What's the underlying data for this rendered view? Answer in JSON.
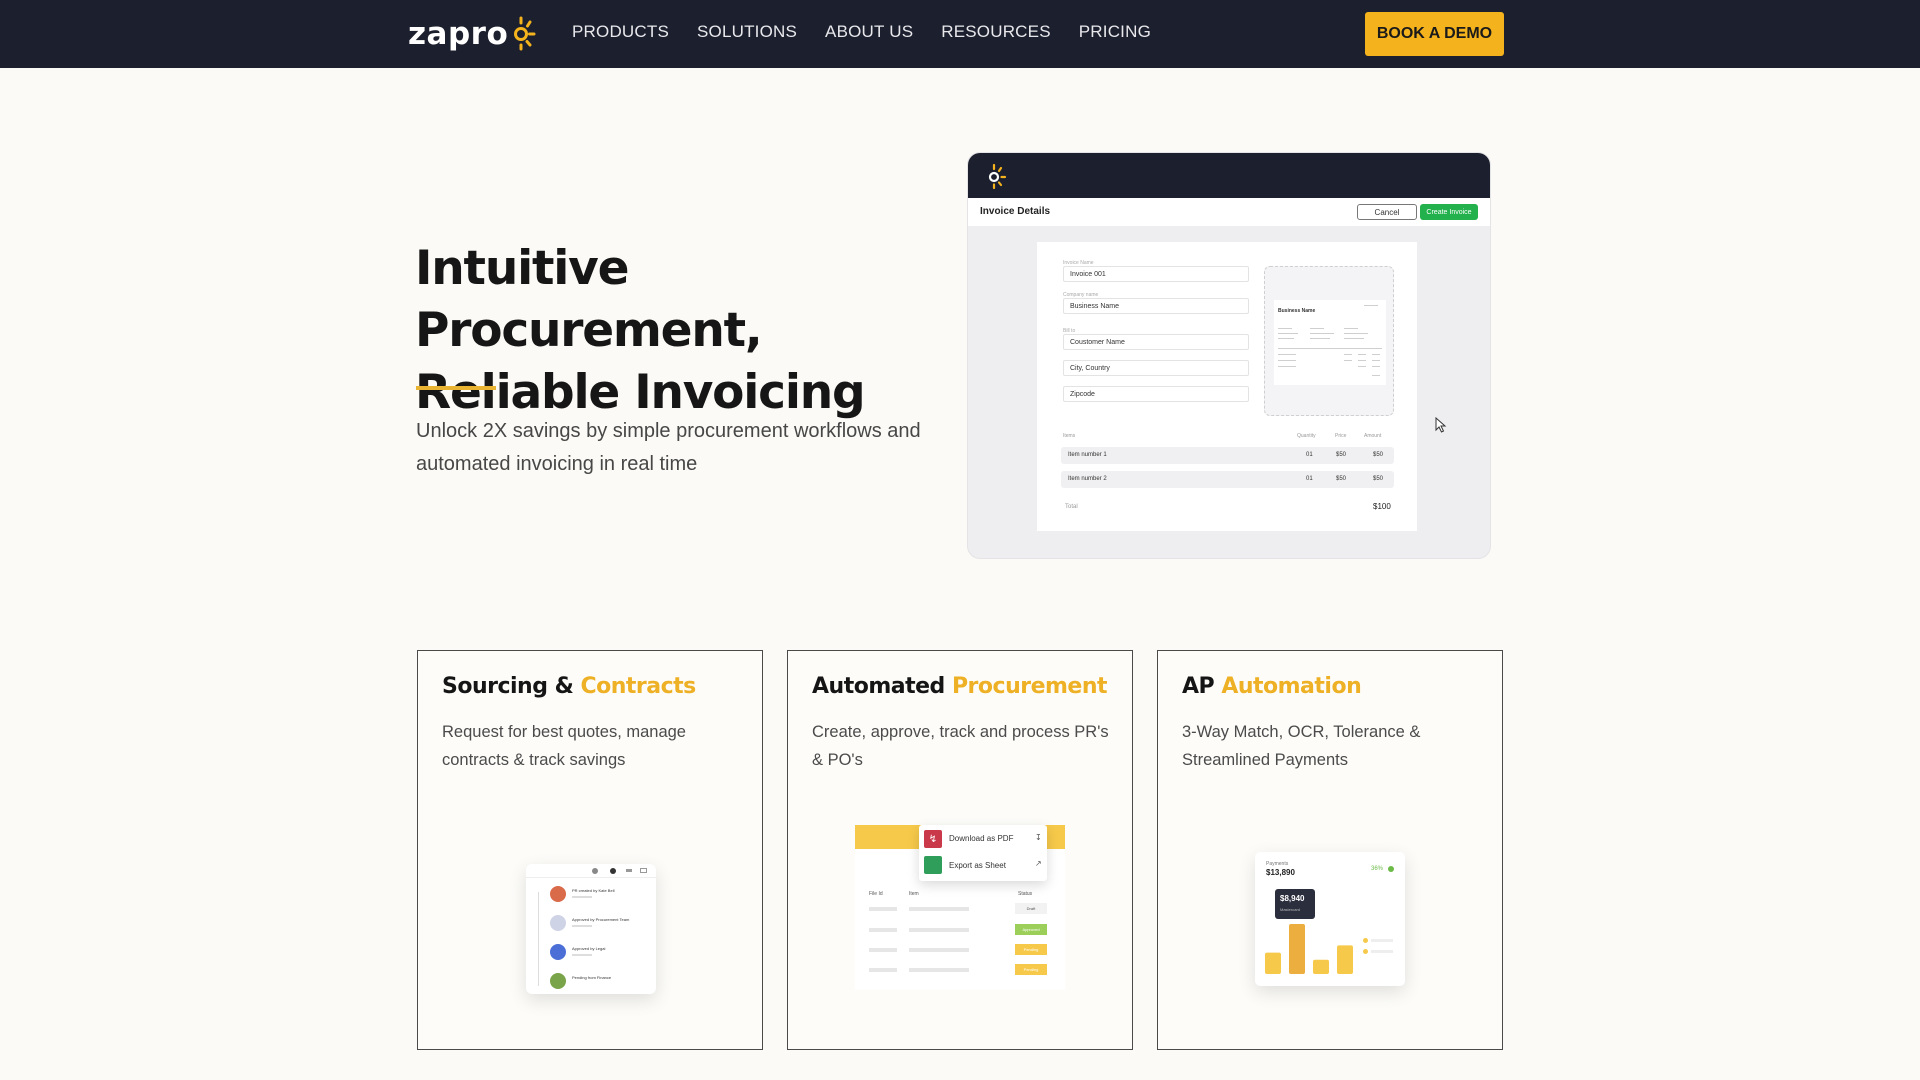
{
  "nav": {
    "logo_text": "zapro",
    "links": [
      "PRODUCTS",
      "SOLUTIONS",
      "ABOUT US",
      "RESOURCES",
      "PRICING"
    ],
    "cta_label": "BOOK A DEMO",
    "accent_color": "#f4b31c",
    "bg_color": "#1c1f2e"
  },
  "hero": {
    "title_line1": "Intuitive Procurement,",
    "title_line2": "Reliable Invoicing",
    "subtitle": "Unlock 2X savings by simple procurement workflows and automated invoicing in real time"
  },
  "mockup": {
    "header": "Invoice Details",
    "cancel_label": "Cancel",
    "create_label": "Create Invoice",
    "fields": [
      {
        "label": "Invoice Name",
        "value": "Invoice 001"
      },
      {
        "label": "Company name",
        "value": "Business Name"
      },
      {
        "label": "Bill to",
        "value": "Coustomer Name"
      },
      {
        "label": "",
        "value": "City, Country"
      },
      {
        "label": "",
        "value": "Zipcode"
      }
    ],
    "preview_title": "Business Name",
    "table_headers": {
      "name": "Items",
      "qty": "Quantity",
      "price": "Price",
      "amount": "Amount"
    },
    "items": [
      {
        "name": "Item number 1",
        "qty": "01",
        "price": "$50",
        "amount": "$50"
      },
      {
        "name": "Item number 2",
        "qty": "01",
        "price": "$50",
        "amount": "$50"
      }
    ],
    "total_label": "Total",
    "total_value": "$100"
  },
  "cards": [
    {
      "title_plain": "Sourcing & ",
      "title_highlight": "Contracts",
      "description": "Request for best quotes, manage contracts & track savings",
      "illustration": {
        "timeline": [
          "PR created by Kate Bell",
          "Approved by Procurement Team",
          "Approved by Legal",
          "Pending from Finance"
        ]
      }
    },
    {
      "title_plain": "Automated ",
      "title_highlight": "Procurement",
      "description": "Create, approve, track and process PR's & PO's",
      "illustration": {
        "menu": [
          "Download as PDF",
          "Export as Sheet"
        ],
        "columns": [
          "File Id",
          "Item",
          "Status"
        ],
        "statuses": [
          "Draft",
          "Approved",
          "Pending",
          "Pending"
        ]
      }
    },
    {
      "title_plain": "AP ",
      "title_highlight": "Automation",
      "description": "3-Way Match, OCR, Tolerance & Streamlined Payments",
      "illustration": {
        "label": "Payments",
        "total": "$13,890",
        "change": "36%",
        "tooltip_value": "$8,940",
        "tooltip_label": "Mastercard",
        "bar_values": [
          3,
          7,
          2,
          4
        ]
      }
    }
  ]
}
